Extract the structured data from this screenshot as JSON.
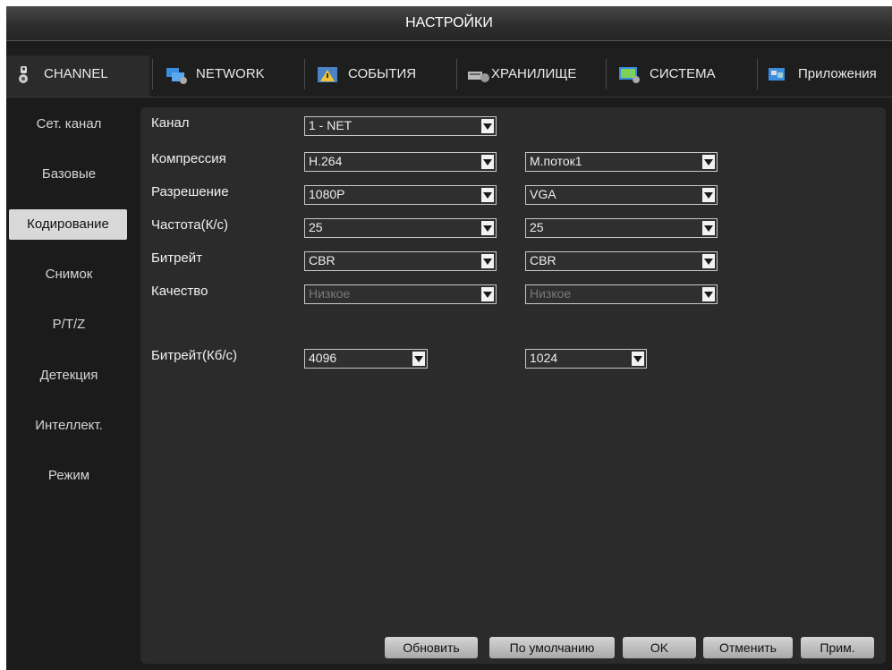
{
  "window": {
    "title": "НАСТРОЙКИ"
  },
  "tabs": [
    {
      "label": "CHANNEL",
      "icon": "camera-icon",
      "active": true
    },
    {
      "label": "NETWORK",
      "icon": "network-icon",
      "active": false
    },
    {
      "label": "СОБЫТИЯ",
      "icon": "events-icon",
      "active": false
    },
    {
      "label": "ХРАНИЛИЩЕ",
      "icon": "storage-icon",
      "active": false
    },
    {
      "label": "СИСТЕМА",
      "icon": "system-icon",
      "active": false
    },
    {
      "label": "Приложения",
      "icon": "applications-icon",
      "active": false
    }
  ],
  "sidebar": {
    "items": [
      {
        "label": "Сет. канал"
      },
      {
        "label": "Базовые"
      },
      {
        "label": "Кодирование",
        "active": true
      },
      {
        "label": "Снимок"
      },
      {
        "label": "P/T/Z"
      },
      {
        "label": "Детекция"
      },
      {
        "label": "Интеллект."
      },
      {
        "label": "Режим"
      }
    ]
  },
  "form": {
    "channel": {
      "label": "Канал",
      "value": "1 - NET"
    },
    "compression": {
      "label": "Компрессия",
      "main": "H.264",
      "sub": "М.поток1"
    },
    "resolution": {
      "label": "Разрешение",
      "main": "1080P",
      "sub": "VGA"
    },
    "fps": {
      "label": "Частота(К/с)",
      "main": "25",
      "sub": "25"
    },
    "bitrate_mode": {
      "label": "Битрейт",
      "main": "CBR",
      "sub": "CBR"
    },
    "quality": {
      "label": "Качество",
      "main": "Низкое",
      "sub": "Низкое"
    },
    "bitrate_kbps": {
      "label": "Битрейт(Кб/с)",
      "main": "4096",
      "sub": "1024"
    }
  },
  "buttons": {
    "refresh": "Обновить",
    "default": "По умолчанию",
    "ok": "OK",
    "cancel": "Отменить",
    "apply": "Прим."
  },
  "colors": {
    "background": "#1b1b1b",
    "panel": "#2b2b2b",
    "active_item": "#d9d9d9",
    "text": "#f0f0f0"
  }
}
